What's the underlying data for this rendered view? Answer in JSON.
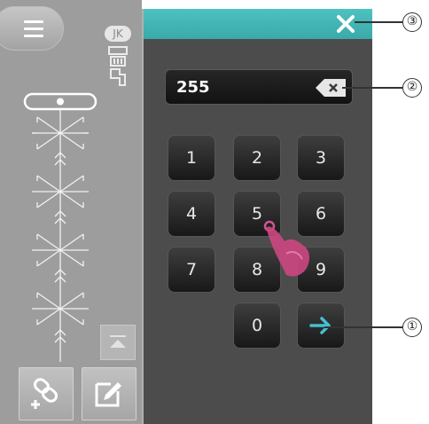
{
  "sidebar": {
    "menu_icon": "hamburger-icon",
    "foot_code": "JK",
    "foot_icon": "presser-foot-icon",
    "stitch_icon": "snowflake-stitch-icon",
    "up_icon": "move-to-top-icon",
    "combine_icon": "link-plus-icon",
    "edit_icon": "edit-pencil-icon"
  },
  "dialog": {
    "accent_color": "#3fb3b3",
    "close_icon": "close-x-icon",
    "value": "255",
    "backspace_icon": "backspace-icon",
    "keys": [
      "1",
      "2",
      "3",
      "4",
      "5",
      "6",
      "7",
      "8",
      "9",
      "0"
    ],
    "enter_icon": "arrow-right-icon"
  },
  "callouts": [
    "①",
    "②",
    "③"
  ]
}
